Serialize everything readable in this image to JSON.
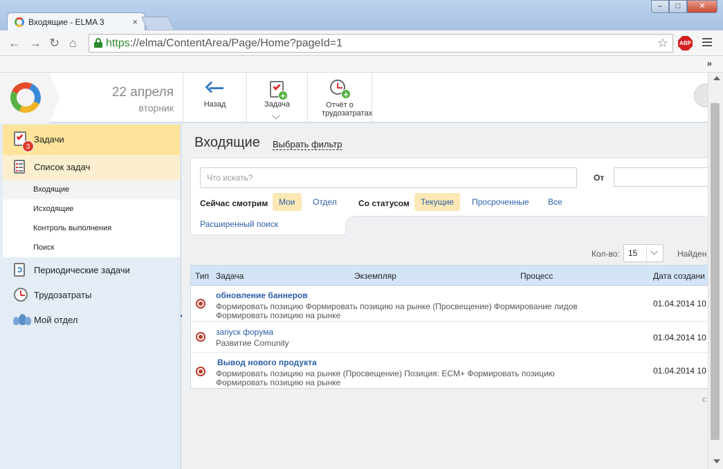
{
  "browser": {
    "tab_title": "Входящие - ELMA 3",
    "tab_close": "×",
    "url_scheme": "https",
    "url_rest": "://elma/ContentArea/Page/Home?pageId=1",
    "abp_label": "ABP",
    "win_min": "–",
    "win_max": "□",
    "win_close": "✕",
    "more": "»"
  },
  "header": {
    "date": "22 апреля",
    "weekday": "вторник",
    "buttons": [
      {
        "label": "Назад"
      },
      {
        "label": "Задача"
      },
      {
        "label": "Отчёт о трудозатратах"
      }
    ]
  },
  "sidebar": {
    "items": [
      {
        "label": "Задачи",
        "badge": "3"
      },
      {
        "label": "Список задач"
      },
      {
        "label": "Периодические задачи"
      },
      {
        "label": "Трудозатраты"
      },
      {
        "label": "Мой отдел"
      }
    ],
    "subitems": [
      {
        "label": "Входящие"
      },
      {
        "label": "Исходящие"
      },
      {
        "label": "Контроль выполнения"
      },
      {
        "label": "Поиск"
      }
    ]
  },
  "main": {
    "title": "Входящие",
    "filter_link": "Выбрать фильтр",
    "search": {
      "placeholder": "Что искать?",
      "from_label": "От",
      "viewing_label": "Сейчас смотрим",
      "viewing_options": [
        {
          "label": "Мои",
          "selected": true
        },
        {
          "label": "Отдел",
          "selected": false
        }
      ],
      "status_label": "Со статусом",
      "status_options": [
        {
          "label": "Текущие",
          "selected": true
        },
        {
          "label": "Просроченные",
          "selected": false
        },
        {
          "label": "Все",
          "selected": false
        }
      ],
      "advanced_link": "Расширенный поиск"
    },
    "paging": {
      "count_label": "Кол-во:",
      "count_value": "15",
      "found_label": "Найден"
    },
    "table": {
      "columns": [
        "Тип",
        "Задача",
        "Экземпляр",
        "Процесс",
        "Дата создани"
      ],
      "rows": [
        {
          "name": "обновление баннеров",
          "desc": "Формировать позицию Формировать позицию на рынке (Просвещение) Формирование лидов Формировать позицию на рынке",
          "date": "01.04.2014 10"
        },
        {
          "name": "запуск форума",
          "desc": "Развитие Comunity",
          "date": "01.04.2014 10"
        },
        {
          "name": "Вывод нового продукта",
          "desc": "Формировать позицию на рынке (Просвещение) Позиция: ECM+ Формировать позицию Формировать позицию на рынке",
          "date": "01.04.2014 10"
        }
      ]
    },
    "corner_char": "с"
  },
  "colors": {
    "accent": "#2b5fa8",
    "active_bg": "#fde49a",
    "header_row": "#d3e4f6",
    "badge": "#e03a2e"
  }
}
